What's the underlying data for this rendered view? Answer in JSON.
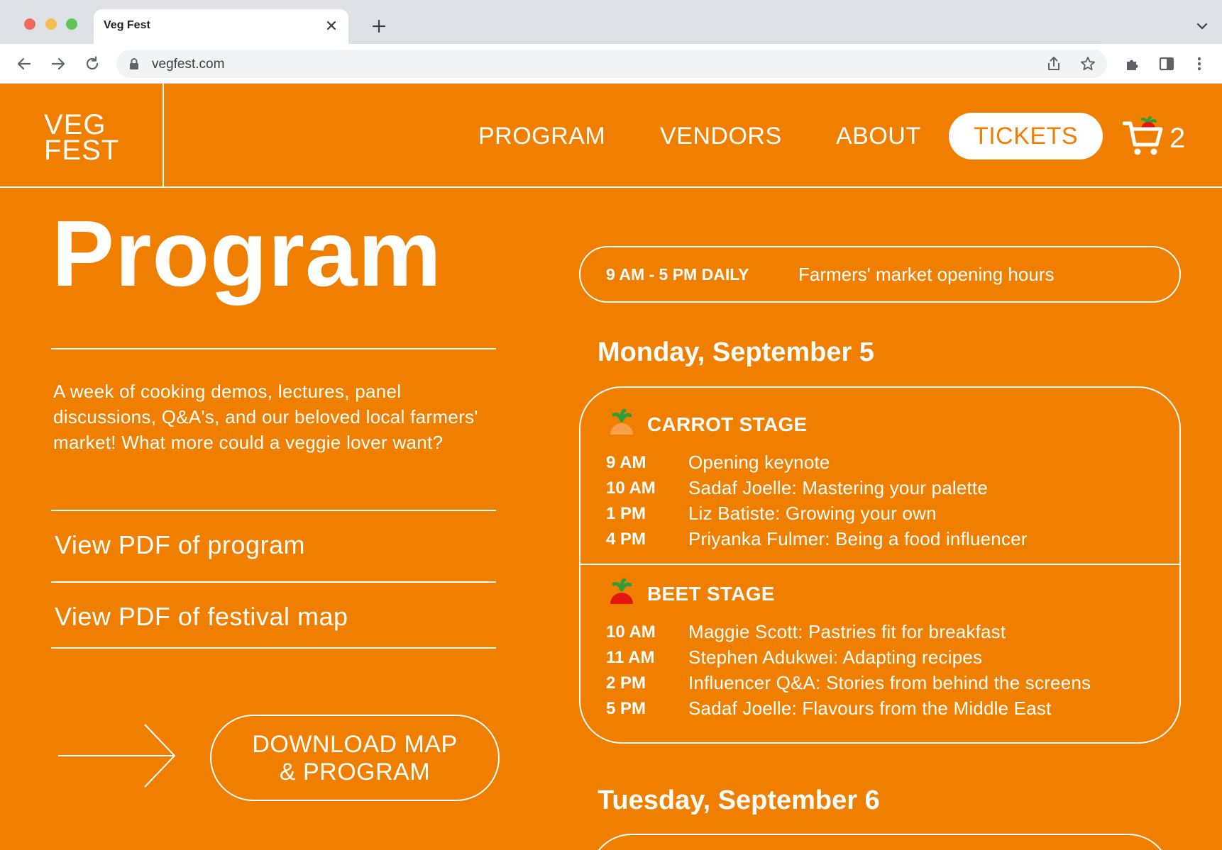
{
  "browser": {
    "tab_title": "Veg Fest",
    "url": "vegfest.com"
  },
  "header": {
    "logo_line1": "VEG",
    "logo_line2": "FEST",
    "nav": [
      "PROGRAM",
      "VENDORS",
      "ABOUT"
    ],
    "tickets_label": "TICKETS",
    "cart_count": "2"
  },
  "left": {
    "title": "Program",
    "intro": "A week of cooking demos, lectures, panel discussions, Q&A's, and our beloved local farmers' market! What more could a veggie lover want?",
    "pdf_program": "View PDF of program",
    "pdf_map": "View PDF of festival map",
    "download_line1": "DOWNLOAD MAP",
    "download_line2": "& PROGRAM"
  },
  "right": {
    "hours_time": "9 AM - 5 PM DAILY",
    "hours_desc": "Farmers' market opening hours",
    "days": [
      {
        "heading": "Monday, September 5",
        "stages": [
          {
            "name": "CARROT STAGE",
            "icon": "carrot-icon",
            "events": [
              {
                "time": "9 AM",
                "title": "Opening keynote"
              },
              {
                "time": "10 AM",
                "title": "Sadaf Joelle: Mastering your palette"
              },
              {
                "time": "1 PM",
                "title": "Liz Batiste: Growing your own"
              },
              {
                "time": "4 PM",
                "title": "Priyanka Fulmer: Being a food influencer"
              }
            ]
          },
          {
            "name": "BEET STAGE",
            "icon": "beet-icon",
            "events": [
              {
                "time": "10 AM",
                "title": "Maggie Scott: Pastries fit for breakfast"
              },
              {
                "time": "11 AM",
                "title": "Stephen Adukwei: Adapting recipes"
              },
              {
                "time": "2 PM",
                "title": "Influencer Q&A: Stories from behind the screens"
              },
              {
                "time": "5 PM",
                "title": "Sadaf Joelle: Flavours from the Middle East"
              }
            ]
          }
        ]
      },
      {
        "heading": "Tuesday, September 6"
      }
    ]
  },
  "colors": {
    "brand_orange": "#f07f00",
    "white": "#ffffff",
    "carrot": "#f7a24a",
    "beet": "#e3160f",
    "leaf": "#2f9e3a"
  }
}
